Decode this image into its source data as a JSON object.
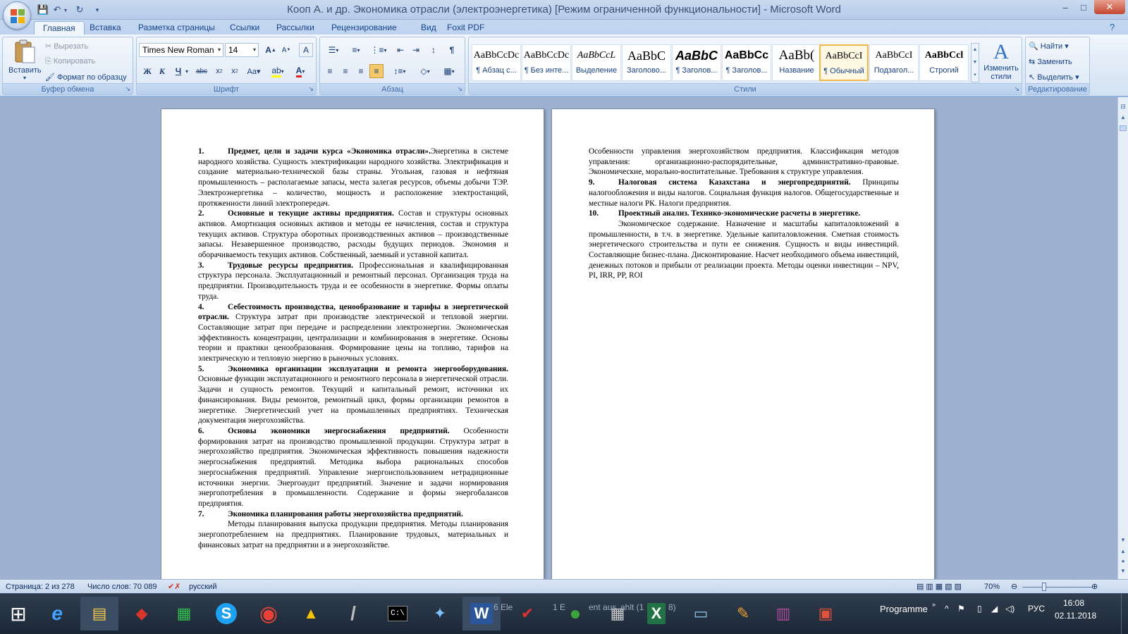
{
  "window": {
    "title": "Кооп А. и др. Экономика отрасли (электроэнергетика) [Режим ограниченной функциональности] - Microsoft Word",
    "controls": {
      "minimize": "–",
      "maximize": "□",
      "close": "✕"
    }
  },
  "tabs": [
    "Главная",
    "Вставка",
    "Разметка страницы",
    "Ссылки",
    "Рассылки",
    "Рецензирование",
    "Вид",
    "Foxit PDF"
  ],
  "ribbon": {
    "clipboard": {
      "paste": "Вставить",
      "cut": "Вырезать",
      "copy": "Копировать",
      "format_painter": "Формат по образцу",
      "label": "Буфер обмена"
    },
    "font": {
      "name": "Times New Roman",
      "size": "14",
      "label": "Шрифт"
    },
    "paragraph": {
      "label": "Абзац"
    },
    "styles": {
      "label": "Стили",
      "items": [
        {
          "sample": "AaBbCcDc",
          "name": "¶ Абзац с..."
        },
        {
          "sample": "AaBbCcDc",
          "name": "¶ Без инте..."
        },
        {
          "sample": "AaBbCcL",
          "name": "Выделение"
        },
        {
          "sample": "AaBbC",
          "name": "Заголово..."
        },
        {
          "sample": "AaBbC",
          "name": "¶ Заголов..."
        },
        {
          "sample": "AaBbCc",
          "name": "¶ Заголов..."
        },
        {
          "sample": "AaBb(",
          "name": "Название"
        },
        {
          "sample": "AaBbCcI",
          "name": "¶ Обычный"
        },
        {
          "sample": "AaBbCcI",
          "name": "Подзагол..."
        },
        {
          "sample": "AaBbCcl",
          "name": "Строгий"
        }
      ],
      "change": "Изменить стили"
    },
    "editing": {
      "find": "Найти",
      "replace": "Заменить",
      "select": "Выделить",
      "label": "Редактирование"
    }
  },
  "page1": [
    {
      "num": "1.",
      "title": "Предмет, цели и задачи курса «Экономика отрасли».",
      "body": "Энергетика в системе народного хозяйства. Сущность электрификации народного хозяйства. Электрификация и создание материально-технической базы страны. Угольная, газовая и нефтяная промышленность – располагаемые запасы, места залегая ресурсов, объемы добычи ТЭР. Электроэнергетика – количество, мощность и расположение электростанций, протяженности линий электропередач."
    },
    {
      "num": "2.",
      "title": "Основные и текущие активы предприятия.",
      "body": "Состав и структуры основных активов. Амортизация основных активов и методы ее начисления, состав и структура текущих активов. Структура оборотных производственных активов – производственные запасы. Незавершенное производство, расходы будущих периодов. Экономия и оборачиваемость текущих активов. Собственный, заемный и уставной капитал."
    },
    {
      "num": "3.",
      "title": "Трудовые ресурсы предприятия.",
      "body": "Профессиональная и квалифицированная структура персонала. Эксплуатационный и ремонтный персонал. Организация труда на предприятии. Производительность труда и ее особенности в энергетике. Формы оплаты труда."
    },
    {
      "num": "4.",
      "title": "Себестоимость производства, ценообразование и тарифы в энергетической отрасли.",
      "body": "Структура затрат при производстве электрической и тепловой энергии. Составляющие затрат при передаче и распределении электроэнергии. Экономическая эффективность концентрации, централизации и комбинирования в энергетике. Основы теории и практики ценообразования. Формирование цены на топливо, тарифов на электрическую и тепловую энергию в рыночных условиях."
    },
    {
      "num": "5.",
      "title": "Экономика организации эксплуатации и ремонта энергооборудования.",
      "body": "Основные функции эксплуатационного и ремонтного персонала в энергетической отрасли. Задачи и сущность ремонтов. Текущий и капитальный ремонт, источники их финансирования. Виды ремонтов, ремонтный цикл, формы организации ремонтов в энергетике. Энергетический учет на промышленных предприятиях. Техническая документация энергохозяйства."
    },
    {
      "num": "6.",
      "title": "Основы экономики энергоснабжения предприятий.",
      "body": "Особенности формирования затрат на производство промышленной продукции. Структура затрат в энергохозяйство предприятия. Экономическая эффективность повышения надежности энергоснабжения предприятий. Методика выбора рациональных способов энергоснабжения предприятий. Управление энергоиспользованием нетрадиционные источники энергии. Энергоаудит предприятий. Значение и задачи нормирования энергопотребления в промышленности. Содержание и формы энергобалансов предприятия."
    },
    {
      "num": "7.",
      "title": "Экономика планирования работы энергохозяйства предприятий.",
      "body": "Методы планирования выпуска продукции предприятия. Методы планирования энергопотреблением на предприятиях. Планирование трудовых, материальных и финансовых затрат на предприятии и в энергохозяйстве."
    }
  ],
  "page2": {
    "intro": "Особенности управления энергохозяйством предприятия. Классификация методов управления: организационно-распорядительные, административно-правовые. Экономические, морально-воспитательные. Требования к структуре управления.",
    "items": [
      {
        "num": "9.",
        "title": "Налоговая система Казахстана и энергопредприятий.",
        "body": "Принципы налогообложения и виды налогов. Социальная функция налогов. Общегосударственные и местные налоги РК. Налоги предприятия."
      },
      {
        "num": "10.",
        "title": "Проектный анализ. Технико-экономические расчеты в энергетике.",
        "body": "Экономическое содержание. Назначение и масштабы капиталовложений в промышленности, в т.ч. в энергетике. Удельные капиталовложения. Сметная стоимость энергетического строительства и пути ее снижения. Сущность и виды инвестиций. Составляющие бизнес-плана. Дисконтирование. Насчет необходимого объема инвестиций, денежных потоков и прибыли от реализации проекта. Методы оценки инвестиции – NPV, PI, IRR, PP, ROI"
      }
    ]
  },
  "statusbar": {
    "page": "Страница: 2 из 278",
    "words": "Число слов: 70 089",
    "language": "русский",
    "zoom": "70%"
  },
  "taskbar": {
    "programme": "Programme",
    "lang": "РУС",
    "time": "16:08",
    "date": "02.11.2018",
    "items": [
      {
        "icon": "windows-start-icon",
        "glyph": "⊞"
      },
      {
        "icon": "internet-explorer-icon",
        "glyph": "e"
      },
      {
        "icon": "file-explorer-icon",
        "glyph": "▤"
      },
      {
        "icon": "filezilla-icon",
        "glyph": "◆"
      },
      {
        "icon": "excel-green-icon",
        "glyph": "▦"
      },
      {
        "icon": "skype-icon",
        "glyph": "S"
      },
      {
        "icon": "chrome-icon",
        "glyph": "◉"
      },
      {
        "icon": "warning-app-icon",
        "glyph": "▲"
      },
      {
        "icon": "microphone-icon",
        "glyph": "/"
      },
      {
        "icon": "cmd-icon",
        "glyph": "C:\\"
      },
      {
        "icon": "network-app-icon",
        "glyph": "✦"
      },
      {
        "icon": "word-icon",
        "glyph": "W"
      },
      {
        "icon": "checkmark-app-icon",
        "glyph": "✔"
      },
      {
        "icon": "frog-app-icon",
        "glyph": "●"
      },
      {
        "icon": "calculator-icon",
        "glyph": "▦"
      },
      {
        "icon": "excel-icon",
        "glyph": "X"
      },
      {
        "icon": "image-viewer-icon",
        "glyph": "▭"
      },
      {
        "icon": "paint-icon",
        "glyph": "✎"
      },
      {
        "icon": "winrar-icon",
        "glyph": "▥"
      },
      {
        "icon": "presentation-icon",
        "glyph": "▣"
      }
    ],
    "ghost_texts": [
      "6 Ele",
      "1 E",
      "ent aus",
      "ahlt (1",
      "8)"
    ]
  }
}
